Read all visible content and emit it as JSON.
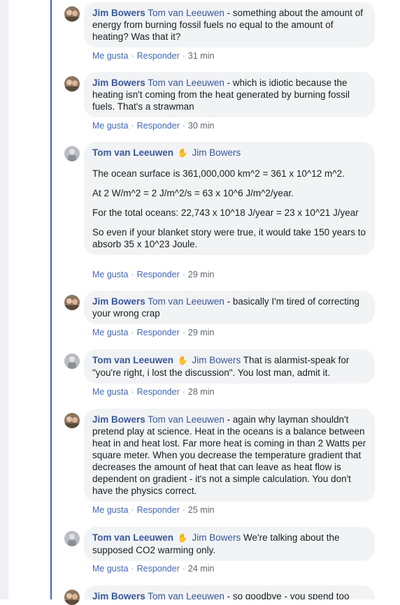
{
  "actions": {
    "like": "Me gusta",
    "reply": "Responder",
    "separator": "·"
  },
  "comments": [
    {
      "author": "Jim Bowers",
      "mention": "Tom van Leeuwen",
      "paragraphs": [
        "- something about the amount of energy from burning fossil fuels no equal to the amount of heating? Was that it?"
      ],
      "time": "31 min"
    },
    {
      "author": "Jim Bowers",
      "mention": "Tom van Leeuwen",
      "paragraphs": [
        "- which is idiotic because the heating isn't coming from the heat generated by burning fossil fuels. That's a strawman"
      ],
      "time": "30 min"
    },
    {
      "author": "Tom van Leeuwen",
      "mention": "Jim Bowers",
      "paragraphs": [
        "The ocean surface is 361,000,000 km^2 = 361 x 10^12 m^2.",
        "At 2 W/m^2 = 2 J/m^2/s = 63 x 10^6 J/m^2/year.",
        "For the total oceans: 22,743 x 10^18 J/year = 23 x 10^21 J/year",
        "So even if your blanket story were true, it would take 150 years to absorb 35 x 10^23 Joule."
      ],
      "time": "29 min"
    },
    {
      "author": "Jim Bowers",
      "mention": "Tom van Leeuwen",
      "paragraphs": [
        "- basically I'm tired of correcting your wrong crap"
      ],
      "time": "29 min"
    },
    {
      "author": "Tom van Leeuwen",
      "mention": "Jim Bowers",
      "paragraphs": [
        "That is alarmist-speak for \"you're right, i lost the discussion\". You lost man, admit it."
      ],
      "time": "28 min"
    },
    {
      "author": "Jim Bowers",
      "mention": "Tom van Leeuwen",
      "paragraphs": [
        "- again why layman shouldn't pretend play at science. Heat in the oceans is a balance between heat in and heat lost. Far more heat is coming in than 2 Watts per square meter. When you decrease the temperature gradient that decreases the amount of heat that can leave as heat flow is dependent on gradient - it's not a simple calculation. You don't have the physics correct."
      ],
      "time": "25 min"
    },
    {
      "author": "Tom van Leeuwen",
      "mention": "Jim Bowers",
      "paragraphs": [
        "We're talking about the supposed CO2 warming only."
      ],
      "time": "24 min"
    },
    {
      "author": "Jim Bowers",
      "mention": "Tom van Leeuwen",
      "paragraphs": [
        "- so goodbye - you spend too"
      ],
      "time": ""
    }
  ],
  "colors": {
    "author": "#385898",
    "bubble": "#f2f3f5",
    "thread_line": "#4267b2",
    "meta": "#606770"
  }
}
